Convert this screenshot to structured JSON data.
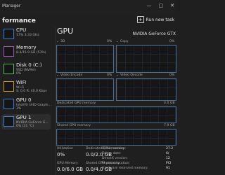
{
  "window": {
    "title": "Manager",
    "controls": [
      "—",
      "▢",
      "✕"
    ]
  },
  "header": {
    "section": "formance",
    "run_task": "Run new task"
  },
  "sidebar": {
    "items": [
      {
        "name": "CPU",
        "sub": "17% 3.33 GHz"
      },
      {
        "name": "Memory",
        "sub": "8.4/15.9 GB (53%)"
      },
      {
        "name": "Disk 0 (C:)",
        "sub": "SSD (NVMe)\n0%"
      },
      {
        "name": "WiFi",
        "sub": "Wi-Fi\nS: 0.0 R: 40.0 Kbps"
      },
      {
        "name": "GPU 0",
        "sub": "Intel(R) UHD Graphi...\n3%"
      },
      {
        "name": "GPU 1",
        "sub": "NVIDIA GeForce G...\n0% (31 °C)"
      }
    ],
    "active_index": 5
  },
  "main": {
    "title": "GPU",
    "model": "NVIDIA GeForce GTX",
    "graphs": {
      "g3d": {
        "label": "3D",
        "pct": "0%"
      },
      "copy": {
        "label": "Copy",
        "pct": "0%"
      },
      "venc": {
        "label": "Video Encode",
        "pct": "0%"
      },
      "vdec": {
        "label": "Video Decode",
        "pct": "0%"
      },
      "dedicated": {
        "label": "Dedicated GPU memory",
        "value": "4.0 GB"
      },
      "shared": {
        "label": "Shared GPU memory",
        "value": "7.9 GB"
      }
    },
    "stats": {
      "utilization_label": "Utilization",
      "utilization": "0%",
      "dedicated_label": "Dedicated GPU memory",
      "dedicated": "0.0/2.0 GB",
      "gpu_memory_label": "GPU Memory",
      "gpu_memory": "0.0/6.0 GB",
      "shared_label": "Shared GPU memory",
      "shared": "0.0/4.0 GB"
    },
    "info": [
      {
        "label": "Driver version:",
        "value": "27.2"
      },
      {
        "label": "Driver date:",
        "value": "6/"
      },
      {
        "label": "DirectX version:",
        "value": "12"
      },
      {
        "label": "Physical location:",
        "value": "PCI"
      },
      {
        "label": "Hardware reserved memory:",
        "value": "91"
      }
    ]
  },
  "colors": {
    "accent": "#3b7bd0",
    "graph_border": "#4a6f99",
    "bg": "#1f1f1f",
    "panel": "#2d2d2d"
  }
}
